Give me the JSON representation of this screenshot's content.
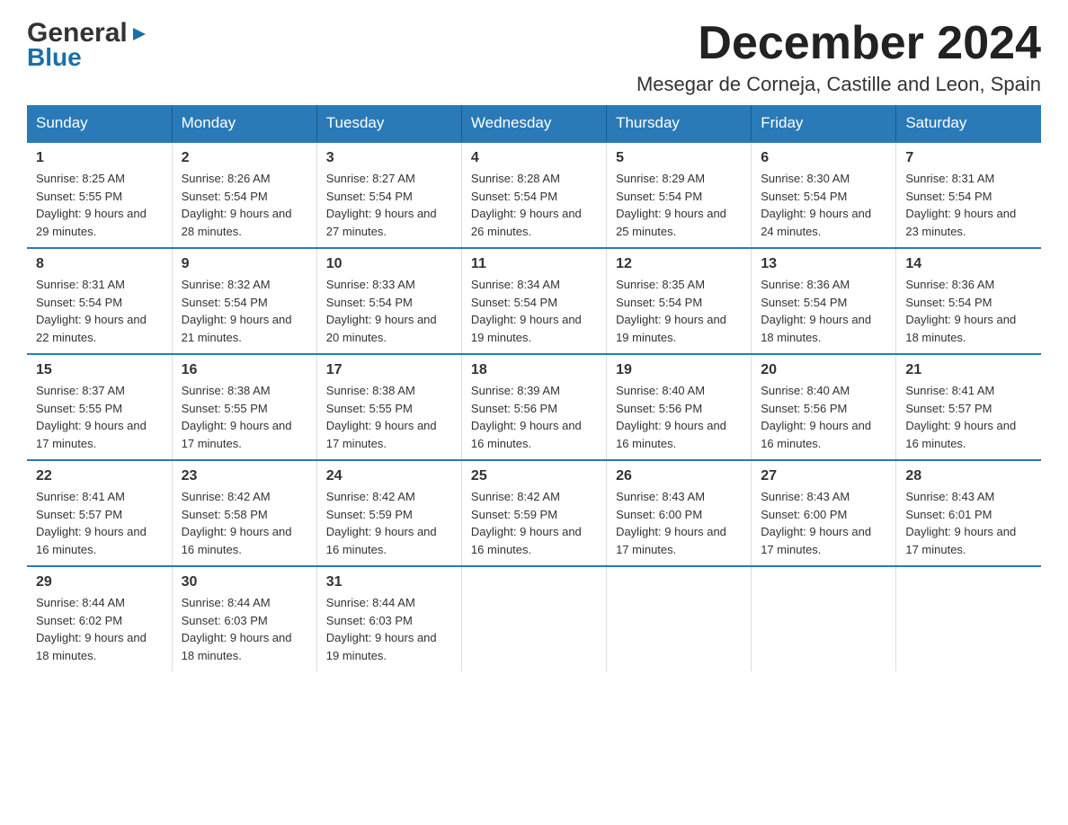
{
  "logo": {
    "general": "General",
    "blue": "Blue",
    "triangle_symbol": "▶"
  },
  "header": {
    "month_title": "December 2024",
    "subtitle": "Mesegar de Corneja, Castille and Leon, Spain"
  },
  "weekdays": [
    "Sunday",
    "Monday",
    "Tuesday",
    "Wednesday",
    "Thursday",
    "Friday",
    "Saturday"
  ],
  "weeks": [
    [
      {
        "day": "1",
        "sunrise": "Sunrise: 8:25 AM",
        "sunset": "Sunset: 5:55 PM",
        "daylight": "Daylight: 9 hours and 29 minutes."
      },
      {
        "day": "2",
        "sunrise": "Sunrise: 8:26 AM",
        "sunset": "Sunset: 5:54 PM",
        "daylight": "Daylight: 9 hours and 28 minutes."
      },
      {
        "day": "3",
        "sunrise": "Sunrise: 8:27 AM",
        "sunset": "Sunset: 5:54 PM",
        "daylight": "Daylight: 9 hours and 27 minutes."
      },
      {
        "day": "4",
        "sunrise": "Sunrise: 8:28 AM",
        "sunset": "Sunset: 5:54 PM",
        "daylight": "Daylight: 9 hours and 26 minutes."
      },
      {
        "day": "5",
        "sunrise": "Sunrise: 8:29 AM",
        "sunset": "Sunset: 5:54 PM",
        "daylight": "Daylight: 9 hours and 25 minutes."
      },
      {
        "day": "6",
        "sunrise": "Sunrise: 8:30 AM",
        "sunset": "Sunset: 5:54 PM",
        "daylight": "Daylight: 9 hours and 24 minutes."
      },
      {
        "day": "7",
        "sunrise": "Sunrise: 8:31 AM",
        "sunset": "Sunset: 5:54 PM",
        "daylight": "Daylight: 9 hours and 23 minutes."
      }
    ],
    [
      {
        "day": "8",
        "sunrise": "Sunrise: 8:31 AM",
        "sunset": "Sunset: 5:54 PM",
        "daylight": "Daylight: 9 hours and 22 minutes."
      },
      {
        "day": "9",
        "sunrise": "Sunrise: 8:32 AM",
        "sunset": "Sunset: 5:54 PM",
        "daylight": "Daylight: 9 hours and 21 minutes."
      },
      {
        "day": "10",
        "sunrise": "Sunrise: 8:33 AM",
        "sunset": "Sunset: 5:54 PM",
        "daylight": "Daylight: 9 hours and 20 minutes."
      },
      {
        "day": "11",
        "sunrise": "Sunrise: 8:34 AM",
        "sunset": "Sunset: 5:54 PM",
        "daylight": "Daylight: 9 hours and 19 minutes."
      },
      {
        "day": "12",
        "sunrise": "Sunrise: 8:35 AM",
        "sunset": "Sunset: 5:54 PM",
        "daylight": "Daylight: 9 hours and 19 minutes."
      },
      {
        "day": "13",
        "sunrise": "Sunrise: 8:36 AM",
        "sunset": "Sunset: 5:54 PM",
        "daylight": "Daylight: 9 hours and 18 minutes."
      },
      {
        "day": "14",
        "sunrise": "Sunrise: 8:36 AM",
        "sunset": "Sunset: 5:54 PM",
        "daylight": "Daylight: 9 hours and 18 minutes."
      }
    ],
    [
      {
        "day": "15",
        "sunrise": "Sunrise: 8:37 AM",
        "sunset": "Sunset: 5:55 PM",
        "daylight": "Daylight: 9 hours and 17 minutes."
      },
      {
        "day": "16",
        "sunrise": "Sunrise: 8:38 AM",
        "sunset": "Sunset: 5:55 PM",
        "daylight": "Daylight: 9 hours and 17 minutes."
      },
      {
        "day": "17",
        "sunrise": "Sunrise: 8:38 AM",
        "sunset": "Sunset: 5:55 PM",
        "daylight": "Daylight: 9 hours and 17 minutes."
      },
      {
        "day": "18",
        "sunrise": "Sunrise: 8:39 AM",
        "sunset": "Sunset: 5:56 PM",
        "daylight": "Daylight: 9 hours and 16 minutes."
      },
      {
        "day": "19",
        "sunrise": "Sunrise: 8:40 AM",
        "sunset": "Sunset: 5:56 PM",
        "daylight": "Daylight: 9 hours and 16 minutes."
      },
      {
        "day": "20",
        "sunrise": "Sunrise: 8:40 AM",
        "sunset": "Sunset: 5:56 PM",
        "daylight": "Daylight: 9 hours and 16 minutes."
      },
      {
        "day": "21",
        "sunrise": "Sunrise: 8:41 AM",
        "sunset": "Sunset: 5:57 PM",
        "daylight": "Daylight: 9 hours and 16 minutes."
      }
    ],
    [
      {
        "day": "22",
        "sunrise": "Sunrise: 8:41 AM",
        "sunset": "Sunset: 5:57 PM",
        "daylight": "Daylight: 9 hours and 16 minutes."
      },
      {
        "day": "23",
        "sunrise": "Sunrise: 8:42 AM",
        "sunset": "Sunset: 5:58 PM",
        "daylight": "Daylight: 9 hours and 16 minutes."
      },
      {
        "day": "24",
        "sunrise": "Sunrise: 8:42 AM",
        "sunset": "Sunset: 5:59 PM",
        "daylight": "Daylight: 9 hours and 16 minutes."
      },
      {
        "day": "25",
        "sunrise": "Sunrise: 8:42 AM",
        "sunset": "Sunset: 5:59 PM",
        "daylight": "Daylight: 9 hours and 16 minutes."
      },
      {
        "day": "26",
        "sunrise": "Sunrise: 8:43 AM",
        "sunset": "Sunset: 6:00 PM",
        "daylight": "Daylight: 9 hours and 17 minutes."
      },
      {
        "day": "27",
        "sunrise": "Sunrise: 8:43 AM",
        "sunset": "Sunset: 6:00 PM",
        "daylight": "Daylight: 9 hours and 17 minutes."
      },
      {
        "day": "28",
        "sunrise": "Sunrise: 8:43 AM",
        "sunset": "Sunset: 6:01 PM",
        "daylight": "Daylight: 9 hours and 17 minutes."
      }
    ],
    [
      {
        "day": "29",
        "sunrise": "Sunrise: 8:44 AM",
        "sunset": "Sunset: 6:02 PM",
        "daylight": "Daylight: 9 hours and 18 minutes."
      },
      {
        "day": "30",
        "sunrise": "Sunrise: 8:44 AM",
        "sunset": "Sunset: 6:03 PM",
        "daylight": "Daylight: 9 hours and 18 minutes."
      },
      {
        "day": "31",
        "sunrise": "Sunrise: 8:44 AM",
        "sunset": "Sunset: 6:03 PM",
        "daylight": "Daylight: 9 hours and 19 minutes."
      },
      null,
      null,
      null,
      null
    ]
  ]
}
